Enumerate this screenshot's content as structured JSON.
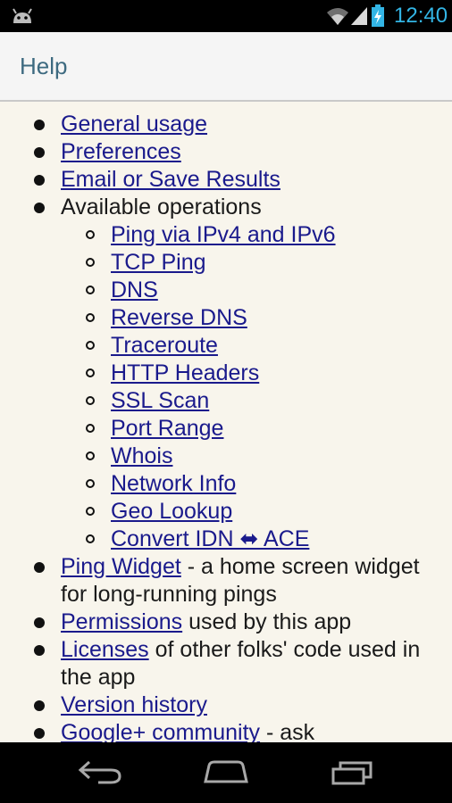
{
  "status_bar": {
    "time": "12:40",
    "icons": [
      "android-icon",
      "wifi-icon",
      "signal-icon",
      "battery-charging-icon"
    ]
  },
  "action_bar": {
    "title": "Help"
  },
  "help_items": [
    {
      "link": "General usage",
      "suffix": ""
    },
    {
      "link": "Preferences",
      "suffix": ""
    },
    {
      "link": "Email or Save Results",
      "suffix": ""
    }
  ],
  "operations": {
    "label": "Available operations",
    "items": [
      "Ping via IPv4 and IPv6",
      "TCP Ping",
      "DNS",
      "Reverse DNS",
      "Traceroute",
      "HTTP Headers",
      "SSL Scan",
      "Port Range",
      "Whois",
      "Network Info",
      "Geo Lookup",
      "Convert IDN ⬌ ACE"
    ]
  },
  "more_items": [
    {
      "link": "Ping Widget",
      "suffix": " - a home screen widget for long-running pings"
    },
    {
      "link": "Permissions",
      "suffix": " used by this app"
    },
    {
      "link": "Licenses",
      "suffix": " of other folks' code used in the app"
    },
    {
      "link": "Version history",
      "suffix": ""
    },
    {
      "link": "Google+ community",
      "suffix": " - ask"
    }
  ],
  "nav_bar": {
    "buttons": [
      "back-icon",
      "home-icon",
      "recent-apps-icon"
    ]
  }
}
